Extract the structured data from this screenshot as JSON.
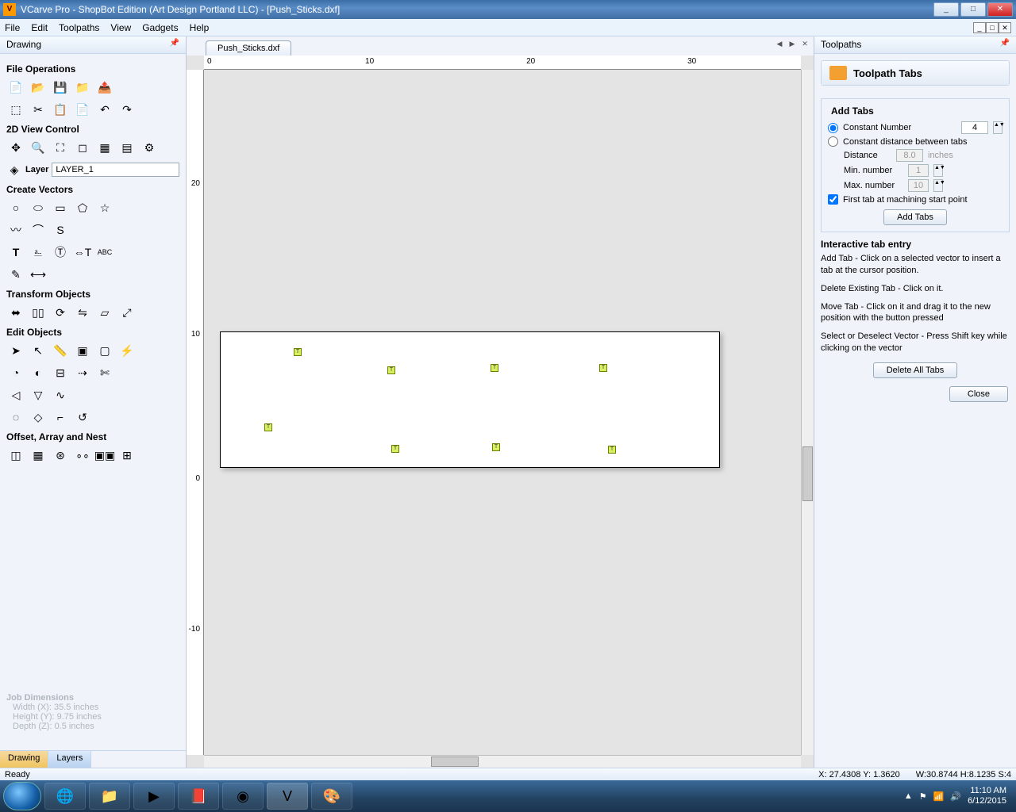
{
  "window": {
    "title": "VCarve Pro - ShopBot Edition (Art Design Portland LLC) - [Push_Sticks.dxf]",
    "min_label": "_",
    "max_label": "□",
    "close_label": "✕"
  },
  "menubar": {
    "items": [
      "File",
      "Edit",
      "Toolpaths",
      "View",
      "Gadgets",
      "Help"
    ]
  },
  "doc_ctrl": {
    "min": "_",
    "max": "□",
    "close": "✕"
  },
  "left": {
    "panel_title": "Drawing",
    "pin": "📌",
    "section_file_ops": "File Operations",
    "section_view": "2D View Control",
    "layer_label": "Layer",
    "layer_value": "LAYER_1",
    "section_create": "Create Vectors",
    "section_transform": "Transform Objects",
    "section_edit": "Edit Objects",
    "section_offset": "Offset, Array and Nest",
    "tab_drawing": "Drawing",
    "tab_layers": "Layers"
  },
  "job_dims": {
    "heading": "Job Dimensions",
    "width": "Width  (X): 35.5 inches",
    "height": "Height (Y): 9.75 inches",
    "depth": "Depth  (Z): 0.5 inches"
  },
  "doctab": {
    "label": "Push_Sticks.dxf"
  },
  "ruler": {
    "h_ticks": [
      "0",
      "10",
      "20",
      "30"
    ],
    "v_ticks": [
      "20",
      "10",
      "0",
      "-10"
    ]
  },
  "right": {
    "panel_title": "Toolpaths",
    "box_title": "Toolpath Tabs",
    "add_tabs_heading": "Add Tabs",
    "radio_const_num": "Constant Number",
    "const_num_val": "4",
    "radio_const_dist": "Constant distance between tabs",
    "dist_label": "Distance",
    "dist_val": "8.0",
    "dist_unit": "inches",
    "min_label": "Min. number",
    "min_val": "1",
    "max_label": "Max. number",
    "max_val": "10",
    "first_tab": "First tab at machining start point",
    "btn_add": "Add Tabs",
    "inter_head": "Interactive tab entry",
    "help1": "Add Tab - Click on a selected vector to insert a tab at the cursor position.",
    "help2": "Delete Existing Tab - Click on it.",
    "help3": "Move Tab - Click on it and drag it to the new position with the button pressed",
    "help4": "Select or Deselect Vector - Press Shift key while clicking on the vector",
    "btn_del_all": "Delete All Tabs",
    "btn_close": "Close"
  },
  "status": {
    "ready": "Ready",
    "coords": "X: 27.4308 Y: 1.3620",
    "dims": "W:30.8744   H:8.1235   S:4"
  },
  "taskbar": {
    "time": "11:10 AM",
    "date": "6/12/2015"
  }
}
